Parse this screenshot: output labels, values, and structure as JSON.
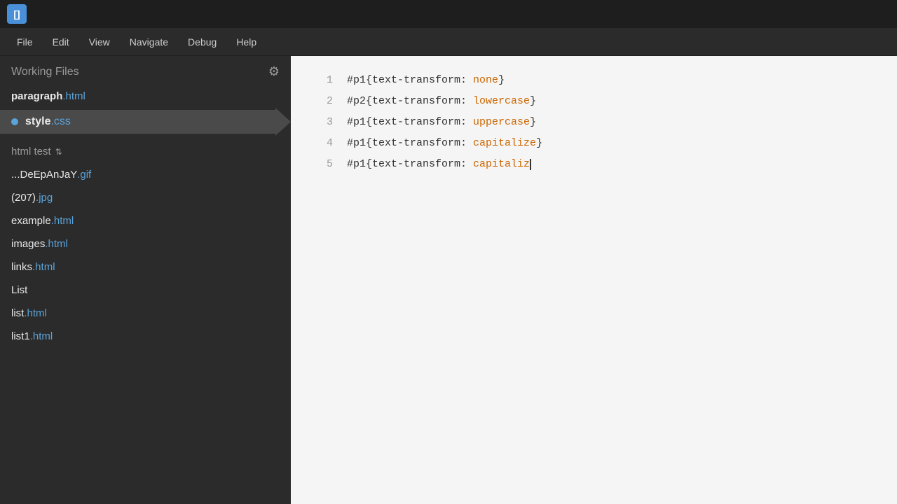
{
  "titlebar": {
    "app_icon": "[]"
  },
  "menubar": {
    "items": [
      {
        "id": "file",
        "label": "File"
      },
      {
        "id": "edit",
        "label": "Edit"
      },
      {
        "id": "view",
        "label": "View"
      },
      {
        "id": "navigate",
        "label": "Navigate"
      },
      {
        "id": "debug",
        "label": "Debug"
      },
      {
        "id": "help",
        "label": "Help"
      }
    ]
  },
  "sidebar": {
    "working_files_title": "Working Files",
    "gear_icon": "⚙",
    "working_files": [
      {
        "id": "paragraph-html",
        "name": "paragraph",
        "ext": ".html",
        "active": false,
        "dot": false
      },
      {
        "id": "style-css",
        "name": "style",
        "ext": ".css",
        "active": true,
        "dot": true
      }
    ],
    "project_title": "html test",
    "project_arrow": "⇅",
    "project_files": [
      {
        "id": "deepanjay-gif",
        "name": "...DeEpAnJaY",
        "ext": ".gif"
      },
      {
        "id": "207-jpg",
        "name": "(207)",
        "ext": ".jpg"
      },
      {
        "id": "example-html",
        "name": "example",
        "ext": ".html"
      },
      {
        "id": "images-html",
        "name": "images",
        "ext": ".html"
      },
      {
        "id": "links-html",
        "name": "links",
        "ext": ".html"
      },
      {
        "id": "list-noext",
        "name": "List",
        "ext": ""
      },
      {
        "id": "list-html",
        "name": "list",
        "ext": ".html"
      },
      {
        "id": "list1-html",
        "name": "list1",
        "ext": ".html"
      }
    ]
  },
  "editor": {
    "lines": [
      {
        "number": "1",
        "selector": "#p1",
        "property": "{text-transform: ",
        "value": "none",
        "suffix": "}"
      },
      {
        "number": "2",
        "selector": "#p2",
        "property": "{text-transform: ",
        "value": "lowercase",
        "suffix": "}"
      },
      {
        "number": "3",
        "selector": "#p1",
        "property": "{text-transform: ",
        "value": "uppercase",
        "suffix": "}"
      },
      {
        "number": "4",
        "selector": "#p1",
        "property": "{text-transform: ",
        "value": "capitalize",
        "suffix": "}"
      },
      {
        "number": "5",
        "selector": "#p1",
        "property": "{text-transform: ",
        "value": "capitaliz",
        "suffix": "",
        "cursor": true
      }
    ]
  }
}
